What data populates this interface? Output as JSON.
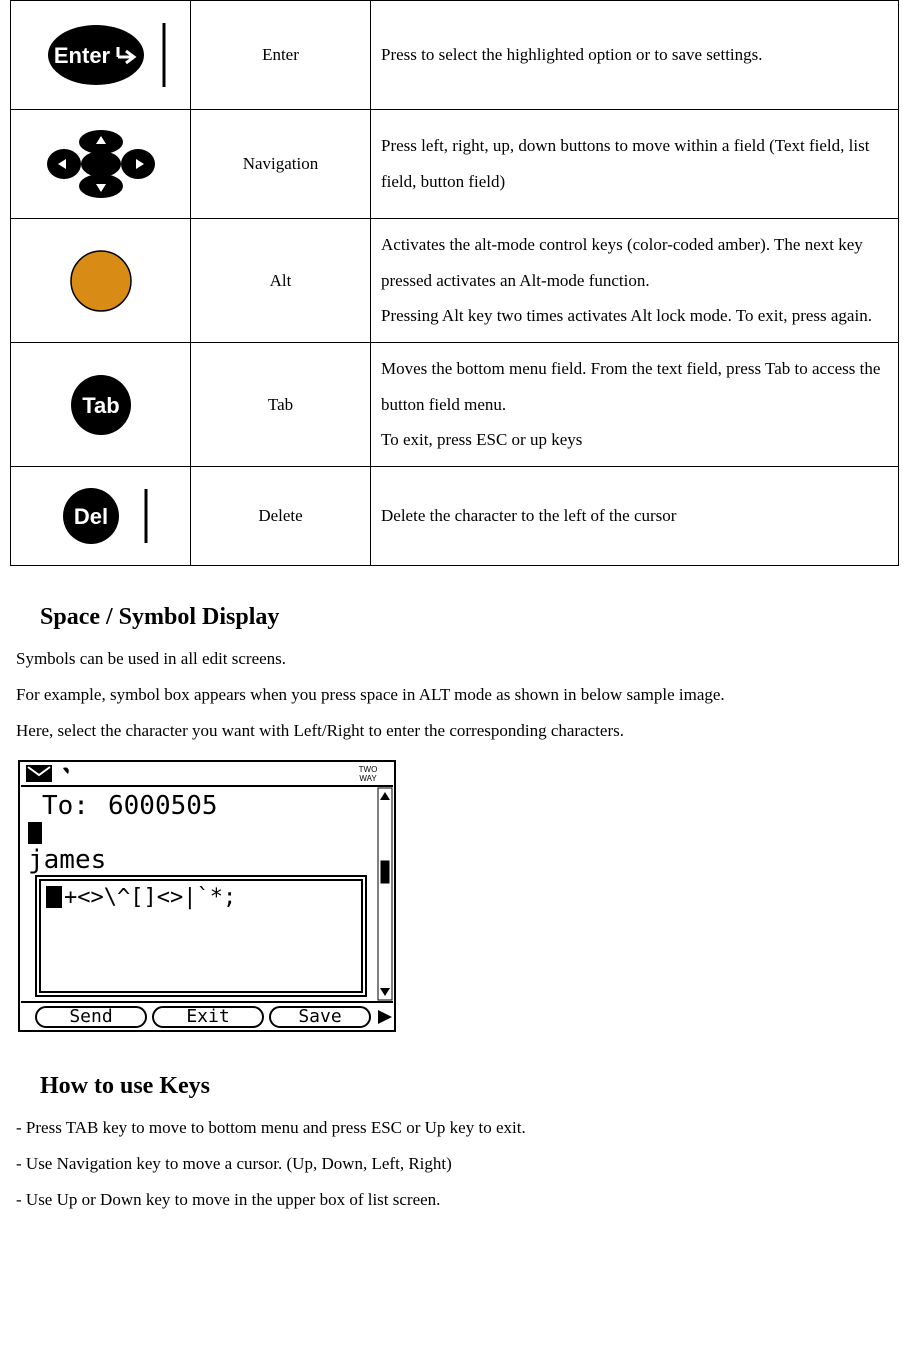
{
  "keys": [
    {
      "name": "Enter",
      "desc": "Press to select the highlighted option or to save settings."
    },
    {
      "name": "Navigation",
      "desc": "Press left, right, up, down buttons to move within a field (Text field, list field, button field)"
    },
    {
      "name": "Alt",
      "desc": "Activates the alt-mode control keys (color-coded amber). The next key pressed activates an Alt-mode function.\nPressing Alt key two times activates Alt lock mode. To exit, press again."
    },
    {
      "name": "Tab",
      "desc": "Moves the bottom menu field. From the text field, press Tab to access the button field menu.\nTo exit, press ESC or up keys"
    },
    {
      "name": "Delete",
      "desc": "Delete the character to the left of the cursor"
    }
  ],
  "section_space_title": "Space / Symbol Display",
  "space_text": "Symbols can be used in all edit screens.\nFor example, symbol box appears when you press space in ALT mode as shown in below sample image.\nHere, select the character you want with Left/Right to enter the corresponding characters.",
  "device_screen": {
    "to_label": "To:",
    "to_value": "6000505",
    "name": "james",
    "symbol_row": "+<>\\^[]<>|`*;",
    "buttons": [
      "Send",
      "Exit",
      "Save"
    ],
    "corner_text": "TWO\nWAY"
  },
  "section_keys_title": "How to use Keys",
  "key_instructions": [
    "- Press TAB key to move to bottom menu and press ESC or Up key to exit.",
    "- Use Navigation key to move a cursor. (Up, Down, Left, Right)",
    "- Use Up or Down key to move in the upper box of list screen."
  ]
}
